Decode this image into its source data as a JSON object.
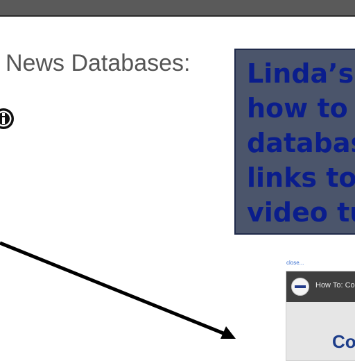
{
  "page": {
    "heading": "News Databases:"
  },
  "icons": {
    "info": "info-icon"
  },
  "callout": {
    "lines": [
      "Linda’s",
      "how to",
      "databas",
      "links to",
      "video tu"
    ]
  },
  "video": {
    "close_label": "close...",
    "title": "How To: Co",
    "body_text": "Co"
  },
  "colors": {
    "callout_bg": "#4b556b",
    "callout_text": "#0a1d8c",
    "arrow": "#000000",
    "heading": "#555555"
  }
}
